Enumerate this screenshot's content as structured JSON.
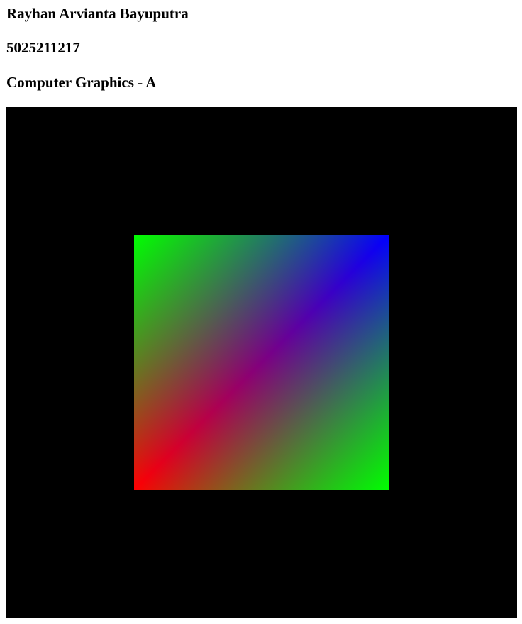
{
  "header": {
    "name": "Rayhan Arvianta Bayuputra",
    "student_id": "5025211217",
    "course": "Computer Graphics - A"
  },
  "canvas": {
    "background": "#000000",
    "square": {
      "corner_colors": {
        "top_left": "#00ff00",
        "top_right": "#0000ff",
        "bottom_left": "#ff0000",
        "bottom_right": "#00ff00"
      }
    }
  }
}
